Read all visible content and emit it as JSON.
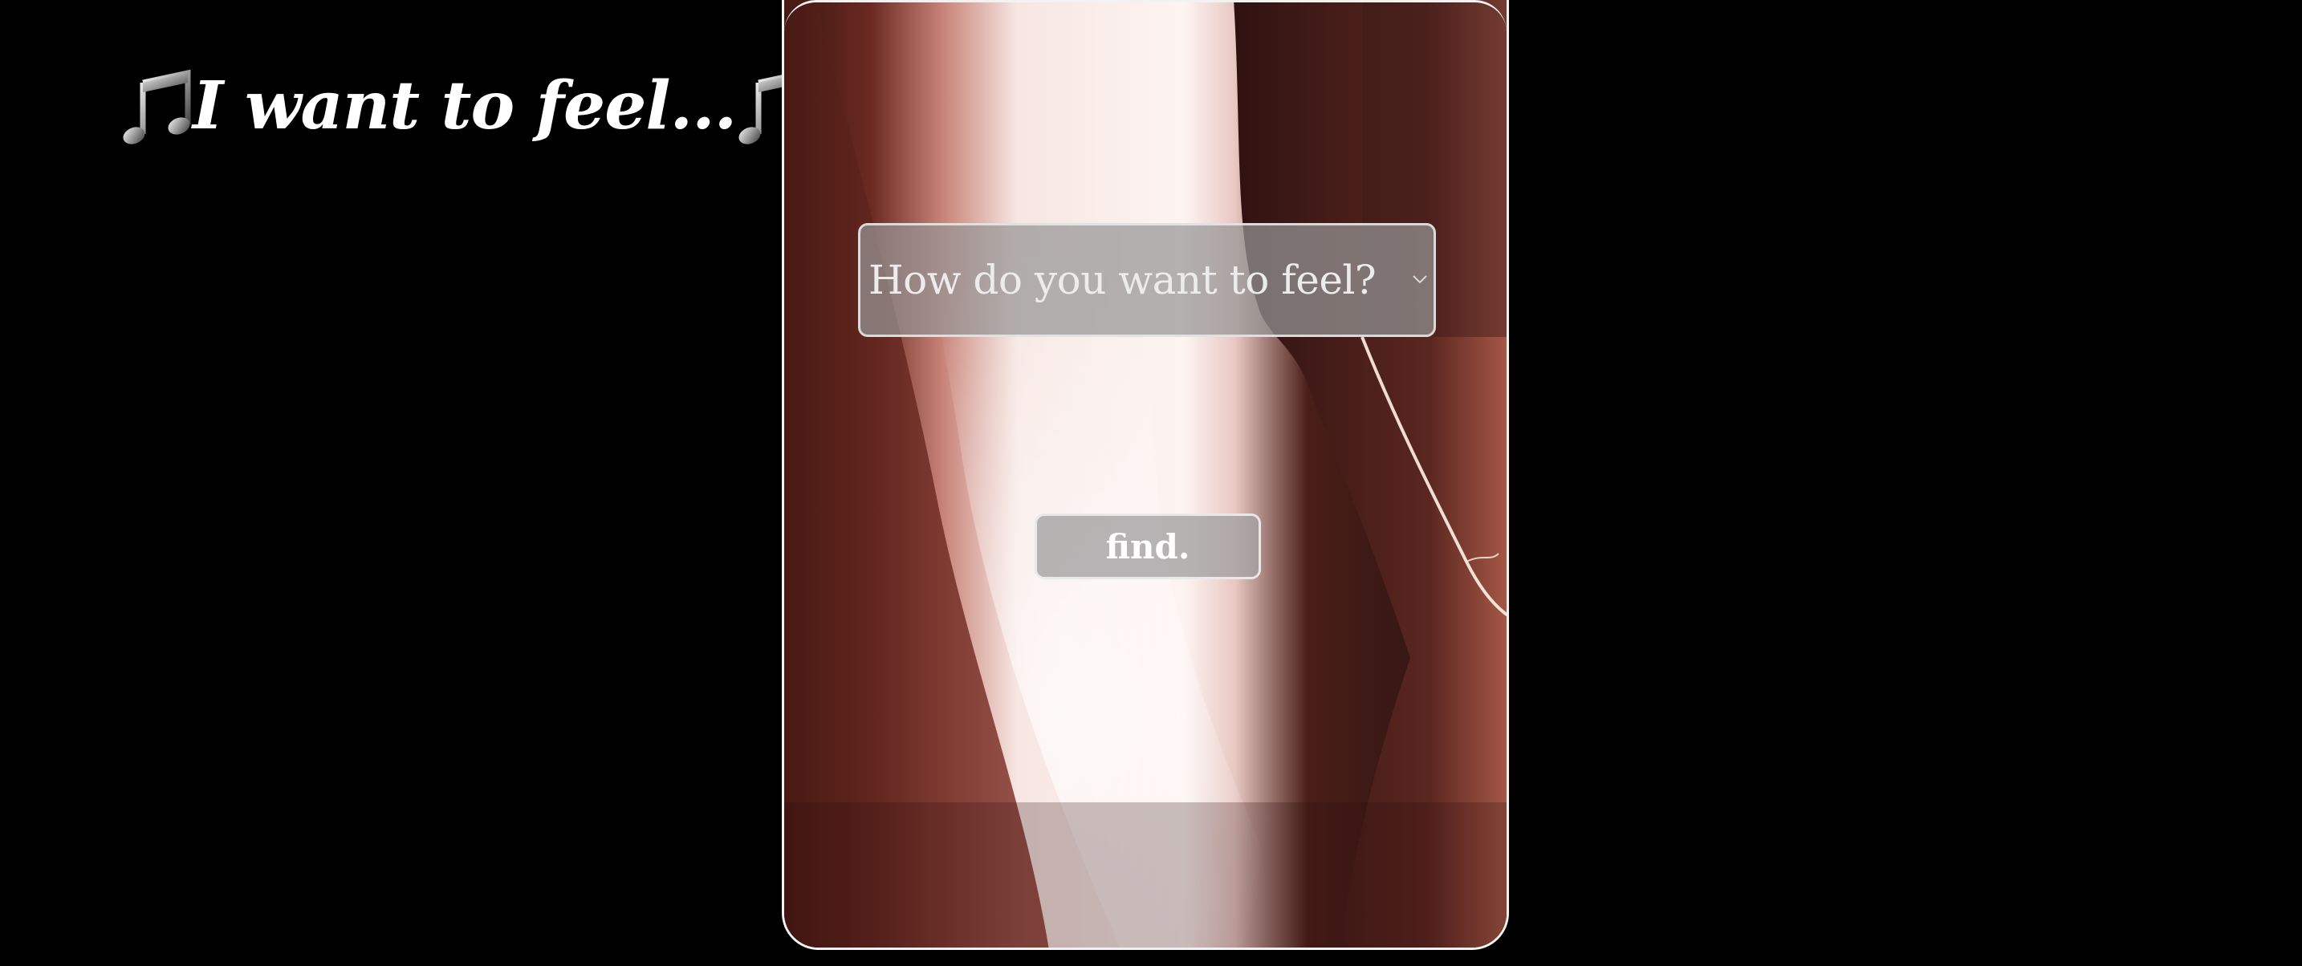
{
  "header": {
    "title": "I want to feel...",
    "left_icon": "music-notes-icon",
    "right_icon": "music-notes-icon"
  },
  "card": {
    "background": "backlit-figure-photo",
    "feel_select": {
      "placeholder": "How do you want to feel?",
      "icon": "chevron-down-icon"
    },
    "find_button": {
      "label": "find."
    }
  },
  "colors": {
    "page_background": "#000000",
    "title_text": "#ffffff",
    "control_fill": "#969696",
    "control_border": "#ebebeb"
  }
}
